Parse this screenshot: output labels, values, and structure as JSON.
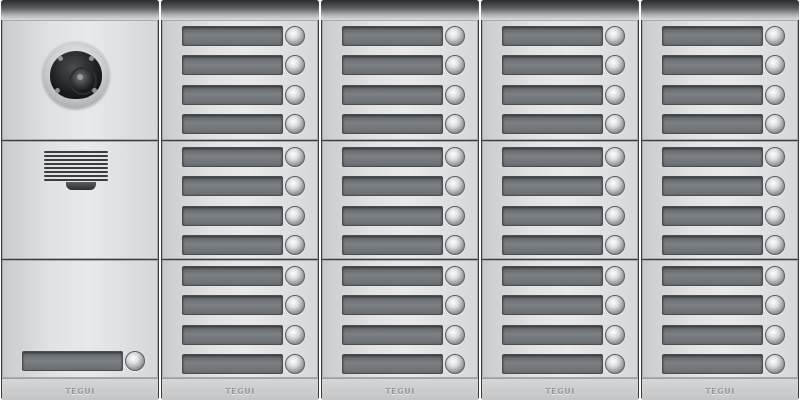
{
  "brand": "TEGUI",
  "components": {
    "camera": "camera-icon",
    "speaker": "speaker-grille-icon"
  },
  "colors": {
    "frame": "#3a3d40",
    "panel": "#dfe1e2",
    "nameplate": "#6f7478"
  }
}
